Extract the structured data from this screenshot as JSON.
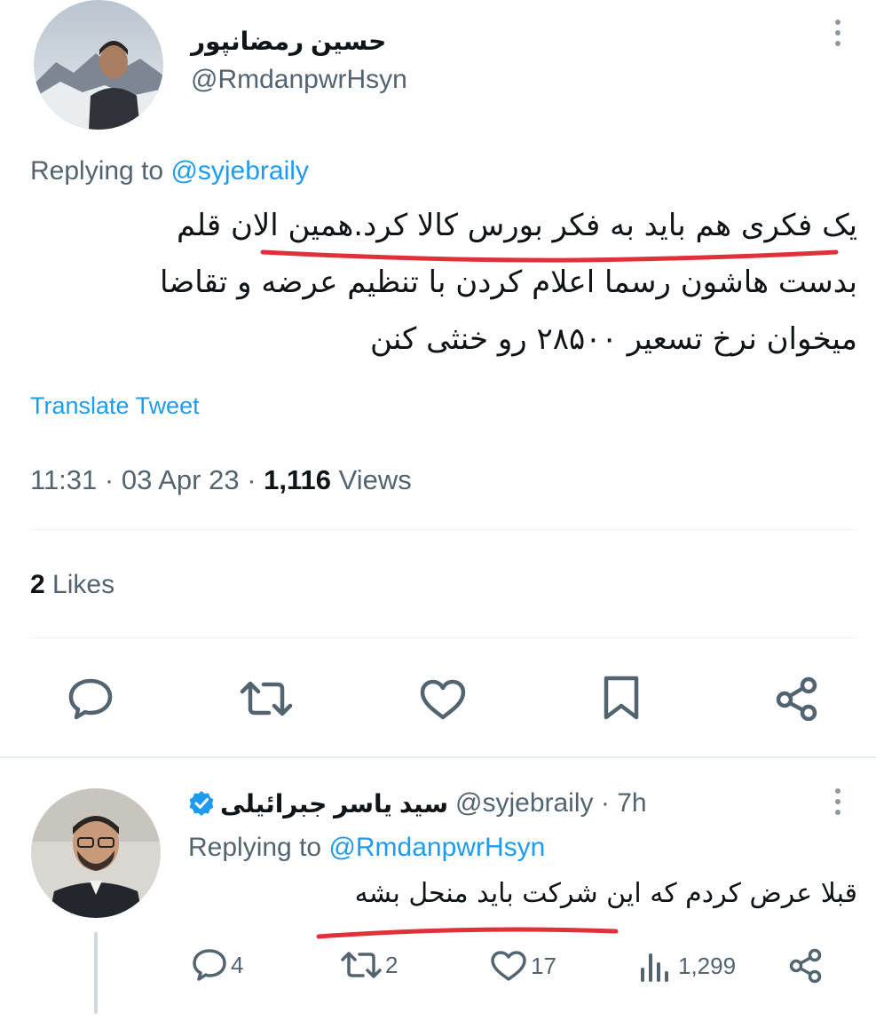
{
  "tweet": {
    "author": {
      "name": "حسین رمضانپور",
      "handle": "@RmdanpwrHsyn"
    },
    "replying_label": "Replying to",
    "replying_to": "@syjebraily",
    "lines": [
      "یک فکری هم باید به فکر بورس کالا کرد.همین الان قلم",
      "بدست هاشون رسما اعلام کردن با تنظیم عرضه و تقاضا",
      "میخوان نرخ تسعیر ۲۸۵۰۰ رو خنثی کنن"
    ],
    "translate_label": "Translate Tweet",
    "time": "11:31",
    "date": "03 Apr 23",
    "views_count": "1,116",
    "views_label": "Views",
    "likes_count": "2",
    "likes_label": "Likes"
  },
  "reply": {
    "author": {
      "name": "سید یاسر جبرائیلی",
      "handle": "@syjebraily",
      "age": "7h",
      "verified": true
    },
    "replying_label": "Replying to",
    "replying_to": "@RmdanpwrHsyn",
    "text": "قبلا عرض کردم که این شرکت باید منحل بشه",
    "stats": {
      "replies": "4",
      "retweets": "2",
      "likes": "17",
      "views": "1,299"
    }
  },
  "colors": {
    "accent": "#1d9bf0",
    "secondary_text": "#536471",
    "highlight_mark": "#e0303a"
  },
  "icons": [
    "more-icon",
    "reply-icon",
    "retweet-icon",
    "like-icon",
    "bookmark-icon",
    "share-icon",
    "verified-icon",
    "views-icon"
  ]
}
